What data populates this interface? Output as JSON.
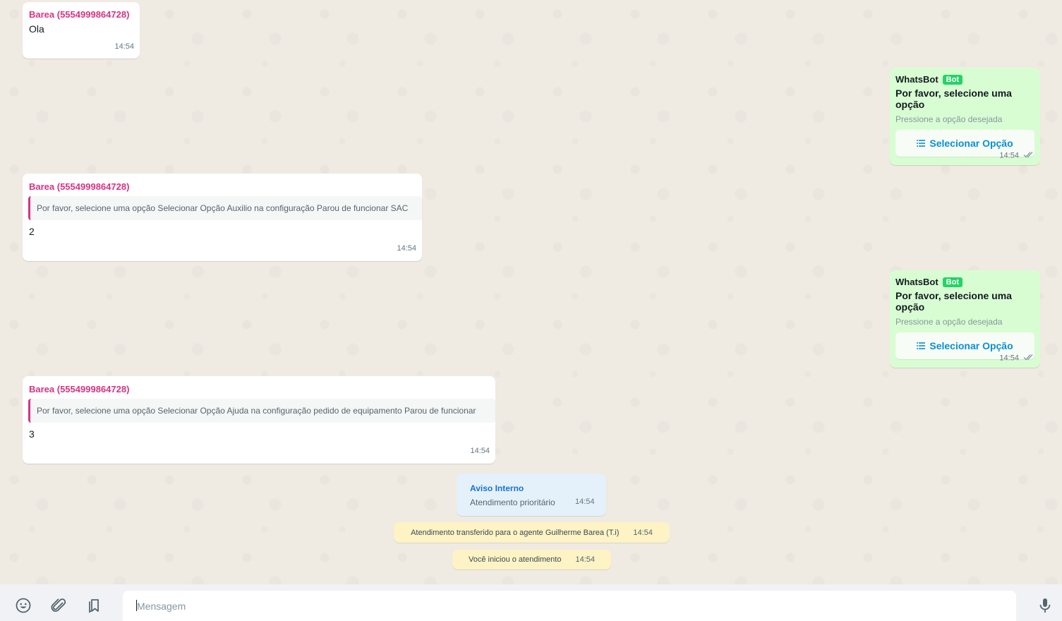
{
  "messages": {
    "m1": {
      "sender": "Barea (5554999864728)",
      "text": "Ola",
      "time": "14:54"
    },
    "bot1": {
      "name": "WhatsBot",
      "badge": "Bot",
      "title": "Por favor, selecione uma opção",
      "subtitle": "Pressione a opção desejada",
      "button": "Selecionar Opção",
      "time": "14:54"
    },
    "m2": {
      "sender": "Barea (5554999864728)",
      "quote": "Por favor, selecione uma opção Selecionar Opção Auxilio na configuração Parou de funcionar SAC",
      "text": "2",
      "time": "14:54"
    },
    "bot2": {
      "name": "WhatsBot",
      "badge": "Bot",
      "title": "Por favor, selecione uma opção",
      "subtitle": "Pressione a opção desejada",
      "button": "Selecionar Opção",
      "time": "14:54"
    },
    "m3": {
      "sender": "Barea (5554999864728)",
      "quote": "Por favor, selecione uma opção Selecionar Opção Ajuda na configuração pedido de equipamento Parou de funcionar",
      "text": "3",
      "time": "14:54"
    }
  },
  "notice": {
    "title": "Aviso Interno",
    "text": "Atendimento prioritário",
    "time": "14:54"
  },
  "system": {
    "transfer": {
      "text": "Atendimento transferido para o agente Guilherme Barea (T.i)",
      "time": "14:54"
    },
    "started": {
      "text": "Você  iniciou o atendimento",
      "time": "14:54"
    }
  },
  "composer": {
    "placeholder": "Mensagem"
  },
  "icons": {
    "emoji": "emoji-icon",
    "attach": "paperclip-icon",
    "quick_replies": "bookmarks-icon",
    "mic": "microphone-icon",
    "list": "list-icon",
    "read": "double-check-icon"
  },
  "colors": {
    "sender": "#d63384",
    "bot_badge": "#25d366",
    "option_button": "#0a8fd6",
    "outgoing_bubble": "#d9fdd3",
    "notice_bubble": "#e4f1fb",
    "system_bubble": "#fdf3c4",
    "notice_title": "#1a73c9"
  }
}
